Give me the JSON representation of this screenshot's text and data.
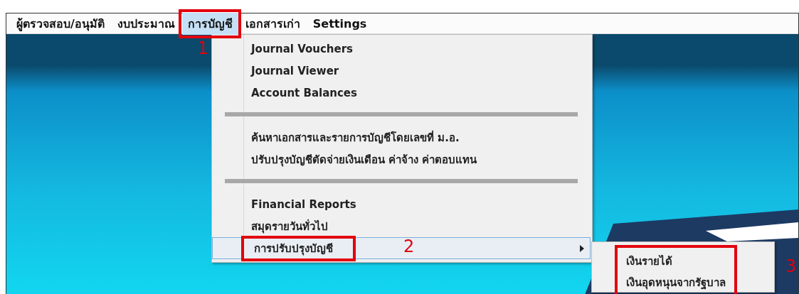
{
  "menubar": {
    "items": [
      {
        "label": "ผู้ตรวจสอบ/อนุมัติ",
        "selected": false
      },
      {
        "label": "งบประมาณ",
        "selected": false
      },
      {
        "label": "การบัญชี",
        "selected": true,
        "callout": "1"
      },
      {
        "label": "เอกสารเก่า",
        "selected": false
      },
      {
        "label": "Settings",
        "selected": false
      }
    ]
  },
  "dropdown": {
    "entries": [
      {
        "kind": "item",
        "label": "Journal Vouchers",
        "selected": false
      },
      {
        "kind": "item",
        "label": "Journal Viewer",
        "selected": false
      },
      {
        "kind": "item",
        "label": "Account Balances",
        "selected": false
      },
      {
        "kind": "separator"
      },
      {
        "kind": "item",
        "label": "ค้นหาเอกสารและรายการบัญชีโดยเลขที่ ม.อ.",
        "selected": false
      },
      {
        "kind": "item",
        "label": "ปรับปรุงบัญชีตัดจ่ายเงินเดือน ค่าจ้าง ค่าตอบแทน",
        "selected": false
      },
      {
        "kind": "separator"
      },
      {
        "kind": "item",
        "label": "Financial Reports",
        "selected": false
      },
      {
        "kind": "item",
        "label": "สมุดรายวันทั่วไป",
        "selected": false
      },
      {
        "kind": "submenu",
        "label": "การปรับปรุงบัญชี",
        "selected": true,
        "callout": "2"
      }
    ]
  },
  "submenu": {
    "callout": "3",
    "items": [
      {
        "label": "เงินรายได้"
      },
      {
        "label": "เงินอุดหนุนจากรัฐบาล"
      }
    ]
  }
}
